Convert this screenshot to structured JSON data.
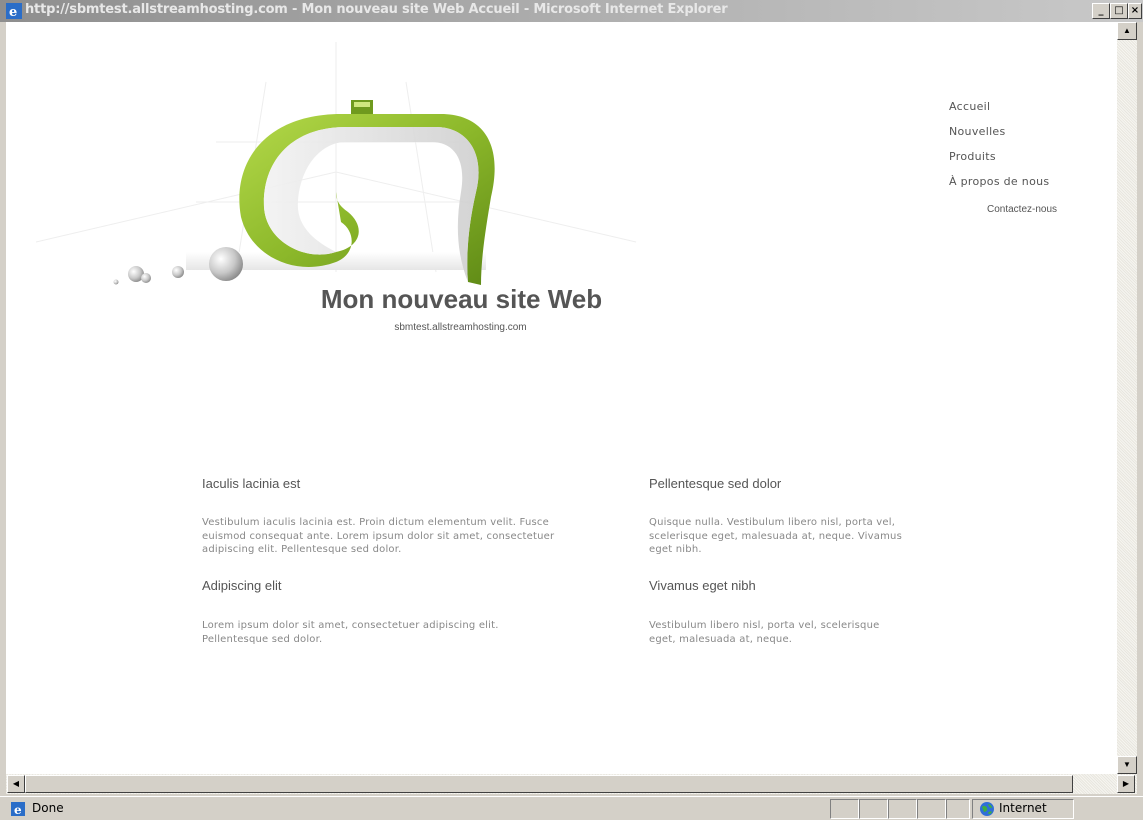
{
  "window": {
    "title": "http://sbmtest.allstreamhosting.com - Mon nouveau site Web Accueil - Microsoft Internet Explorer",
    "minimize": "_",
    "maximize": "□",
    "close": "×"
  },
  "site": {
    "title": "Mon nouveau site Web",
    "subtitle": "sbmtest.allstreamhosting.com"
  },
  "nav": {
    "items": [
      "Accueil",
      "Nouvelles",
      "Produits",
      "À propos de nous"
    ],
    "sub_item": "Contactez-nous"
  },
  "articles": [
    {
      "heading": "Iaculis lacinia est",
      "body": "Vestibulum iaculis lacinia est. Proin dictum elementum velit. Fusce euismod consequat ante. Lorem ipsum dolor sit amet, consectetuer adipiscing elit. Pellentesque sed dolor."
    },
    {
      "heading": "Pellentesque sed dolor",
      "body": "Quisque nulla. Vestibulum libero nisl, porta vel, scelerisque eget, malesuada at, neque. Vivamus eget nibh."
    },
    {
      "heading": "Adipiscing elit",
      "body": "Lorem ipsum dolor sit amet, consectetuer adipiscing elit. Pellentesque sed dolor."
    },
    {
      "heading": "Vivamus eget nibh",
      "body": "Vestibulum libero nisl, porta vel, scelerisque eget, malesuada at, neque."
    }
  ],
  "status": {
    "text": "Done",
    "zone": "Internet"
  },
  "colors": {
    "accent_green": "#8cb82a",
    "text": "#555555",
    "body_text": "#888888"
  }
}
